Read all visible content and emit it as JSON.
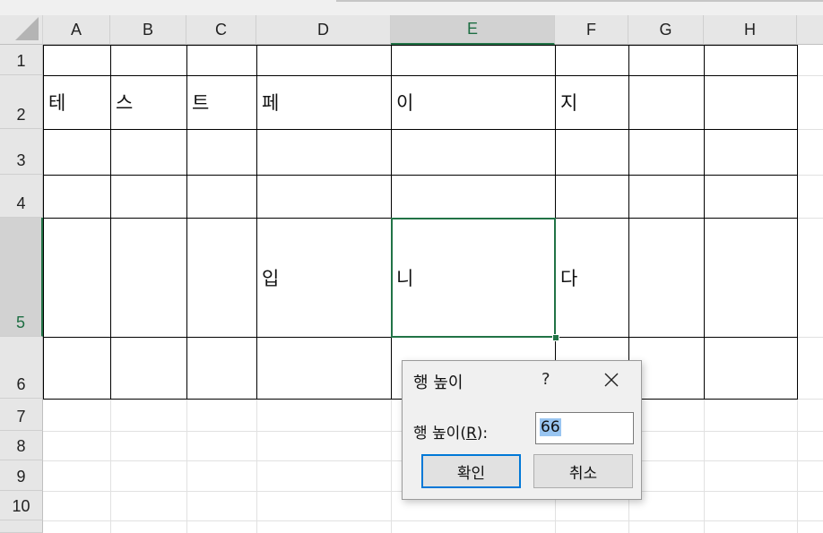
{
  "columns": [
    "A",
    "B",
    "C",
    "D",
    "E",
    "F",
    "G",
    "H"
  ],
  "rows": [
    "1",
    "2",
    "3",
    "4",
    "5",
    "6",
    "7",
    "8",
    "9",
    "10"
  ],
  "selected_column": "E",
  "selected_row": "5",
  "cells": {
    "A2": "테",
    "B2": "스",
    "C2": "트",
    "D2": "페",
    "E2": "이",
    "F2": "지",
    "D5": "입",
    "E5": "니",
    "F5": "다"
  },
  "dialog": {
    "title": "행 높이",
    "help": "?",
    "label_prefix": "행 높이(",
    "label_mnemonic": "R",
    "label_suffix": "):",
    "value": "66",
    "ok_label": "확인",
    "cancel_label": "취소"
  },
  "colors": {
    "accent": "#217346",
    "selection_highlight": "#99c5f1",
    "default_button_border": "#0078d7"
  }
}
